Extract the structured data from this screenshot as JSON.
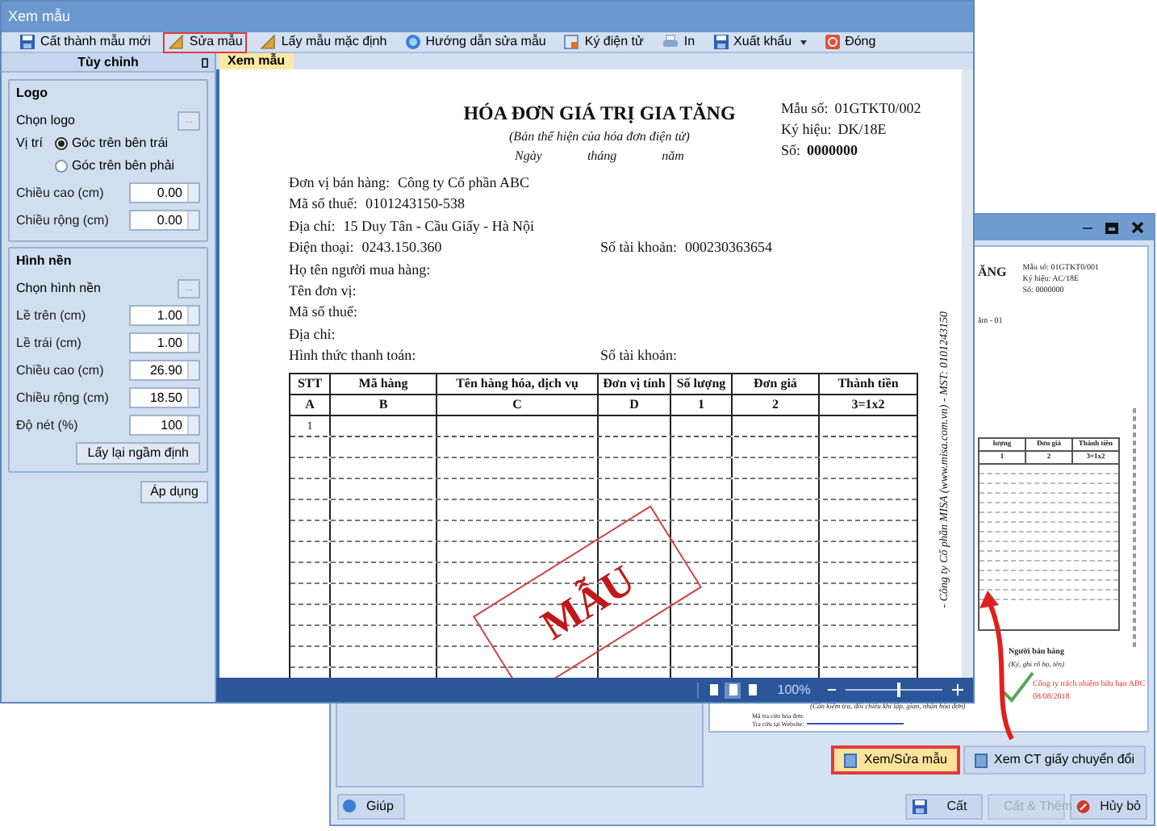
{
  "window": {
    "title": "Xem mẫu"
  },
  "toolbar": [
    {
      "label": "Cất thành mẫu mới",
      "highlighted": false,
      "dropdown": false
    },
    {
      "label": "Sửa mẫu",
      "highlighted": true,
      "dropdown": false
    },
    {
      "label": "Lấy mẫu mặc định",
      "highlighted": false,
      "dropdown": false
    },
    {
      "label": "Hướng dẫn sửa mẫu",
      "highlighted": false,
      "dropdown": false
    },
    {
      "label": "Ký điện tử",
      "highlighted": false,
      "dropdown": false
    },
    {
      "label": "In",
      "highlighted": false,
      "dropdown": false
    },
    {
      "label": "Xuất khẩu",
      "highlighted": false,
      "dropdown": true
    },
    {
      "label": "Đóng",
      "highlighted": false,
      "dropdown": false
    }
  ],
  "side_panel": {
    "title": "Tùy chỉnh",
    "groups": [
      {
        "title": "Logo",
        "picker_label": "Chọn logo",
        "picker_button": "...",
        "position_label": "Vị trí",
        "positions": [
          {
            "label": "Góc trên bên trái",
            "selected": true
          },
          {
            "label": "Góc trên bên phải",
            "selected": false
          }
        ],
        "fields": [
          {
            "label": "Chiều cao (cm)",
            "value": "0.00"
          },
          {
            "label": "Chiều rộng (cm)",
            "value": "0.00"
          }
        ]
      },
      {
        "title": "Hình nền",
        "picker_label": "Chọn hình nền",
        "picker_button": "...",
        "fields": [
          {
            "label": "Lề trên (cm)",
            "value": "1.00"
          },
          {
            "label": "Lề trái (cm)",
            "value": "1.00"
          },
          {
            "label": "Chiều cao (cm)",
            "value": "26.90"
          },
          {
            "label": "Chiều rộng (cm)",
            "value": "18.50"
          },
          {
            "label": "Độ nét (%)",
            "value": "100"
          }
        ],
        "reset_button": "Lấy lại ngầm định"
      }
    ],
    "apply_button": "Áp dụng"
  },
  "tabs": [
    {
      "label": "Xem mẫu",
      "selected": true
    }
  ],
  "invoice": {
    "title": "HÓA ĐƠN GIÁ TRỊ GIA TĂNG",
    "subtitle": "(Bản thể hiện của hóa đơn điện tử)",
    "date_parts": [
      "Ngày",
      "tháng",
      "năm"
    ],
    "meta": [
      {
        "label": "Mẫu số:",
        "value": "01GTKT0/002",
        "bold": false
      },
      {
        "label": "Ký hiệu:",
        "value": "DK/18E",
        "bold": false
      },
      {
        "label": "Số:",
        "value": "0000000",
        "bold": true
      }
    ],
    "lines": [
      {
        "label": "Đơn vị bán hàng:",
        "value": "Công ty Cổ phần ABC"
      },
      {
        "label": "Mã số thuế:",
        "value": "0101243150-538"
      },
      {
        "label": "Địa chỉ:",
        "value": "15 Duy Tân - Cầu Giấy - Hà Nội"
      },
      {
        "label": "Điện thoại:",
        "value": "0243.150.360",
        "right_label": "Số tài khoản:",
        "right_value": "000230363654"
      },
      {
        "label": "Họ tên người mua hàng:"
      },
      {
        "label": "Tên đơn vị:"
      },
      {
        "label": "Mã số thuế:"
      },
      {
        "label": "Địa chỉ:"
      },
      {
        "label": "Hình thức thanh toán:",
        "right_label": "Số tài khoản:"
      }
    ],
    "table": {
      "columns": [
        "STT",
        "Mã hàng",
        "Tên hàng hóa, dịch vụ",
        "Đơn vị tính",
        "Số lượng",
        "Đơn giá",
        "Thành tiền"
      ],
      "codes": [
        "A",
        "B",
        "C",
        "D",
        "1",
        "2",
        "3=1x2"
      ],
      "rows": [
        [
          "1"
        ]
      ]
    },
    "stamp": "MẪU",
    "side_note": "- Công ty Cổ phần MISA (www.misa.com.vn) - MST: 0101243150"
  },
  "status_bar": {
    "views": [
      {
        "selected": false
      },
      {
        "selected": true
      },
      {
        "selected": false
      }
    ],
    "zoom": "100%",
    "level": 0.53
  },
  "background_window": {
    "preview": {
      "title_tail": "ĂNG",
      "meta": [
        "Mẫu số: 01GTKT0/001",
        "Ký hiệu: AC/18E",
        "Số: 0000000"
      ],
      "date_tail": "ăm - 01",
      "table_columns": [
        "lượng",
        "Đơn giá",
        "Thành tiền"
      ],
      "table_codes": [
        "1",
        "2",
        "3=1x2"
      ],
      "seller": "Người bán hàng",
      "seller_hint": "(Ký, ghi rõ họ, tên)",
      "signer": "Công ty trách nhiệm hữu hạn ABC",
      "signed_date": "08/08/2018",
      "check_note": "(Cần kiểm tra, đối chiếu khi lập, giao, nhận hóa đơn)",
      "lookup_lines": [
        "Mã tra cứu hóa đơn:",
        "Tra cứu tại Website:"
      ]
    },
    "buttons": [
      {
        "label": "Xem/Sửa mẫu",
        "highlighted": true
      },
      {
        "label": "Xem CT giấy chuyển đổi",
        "highlighted": false
      }
    ],
    "help_button": "Giúp",
    "footer_buttons": [
      {
        "label": "Cất",
        "disabled": false
      },
      {
        "label": "Cất & Thêm",
        "disabled": true
      },
      {
        "label": "Hủy bỏ",
        "disabled": false
      }
    ]
  }
}
